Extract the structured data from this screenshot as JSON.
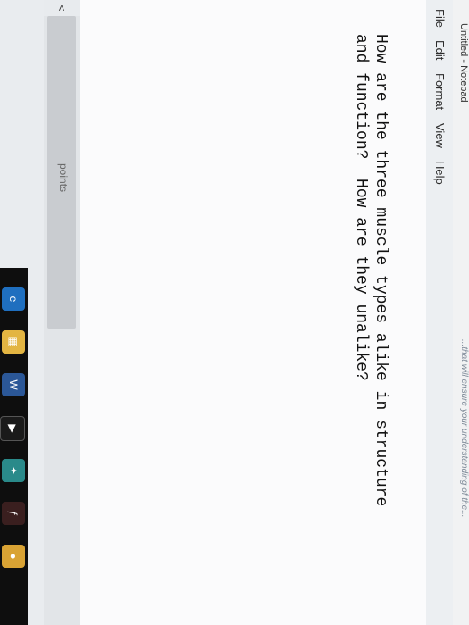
{
  "window": {
    "title": "Untitled - Notepad",
    "background_hint": "...that will ensure your understanding of the..."
  },
  "menu": [
    "File",
    "Edit",
    "Format",
    "View",
    "Help"
  ],
  "editor": {
    "text": "How are the three muscle types alike in structure\nand function?  How are they unalike?"
  },
  "page": {
    "points_label": "points"
  },
  "scrollbar": {
    "left_arrow": "<"
  },
  "taskbar": {
    "icons": [
      "ie-icon",
      "files-icon",
      "word-icon",
      "media-icon",
      "store-icon",
      "firefox-icon",
      "chrome-icon"
    ]
  },
  "colors": {
    "window_bg": "#fbfbfc",
    "menubar_bg": "#eceff2",
    "taskbar_bg": "#0e0e0e"
  }
}
